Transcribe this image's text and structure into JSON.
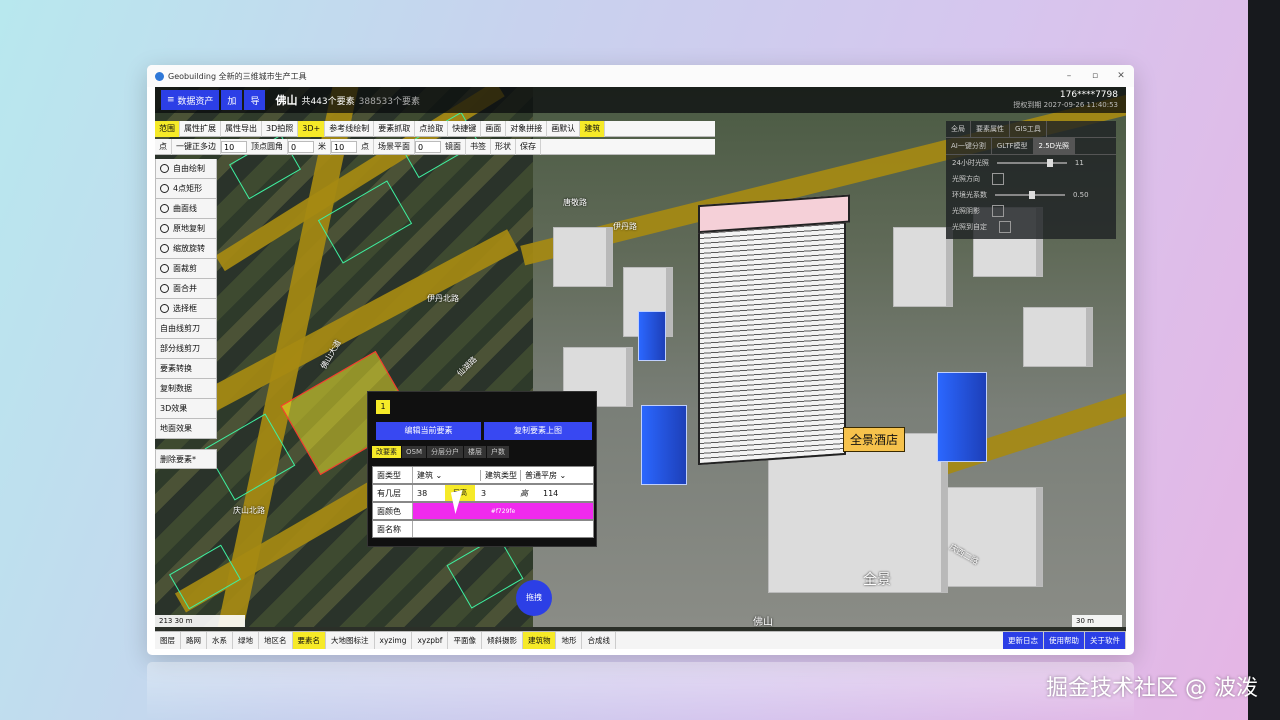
{
  "window": {
    "title": "Geobuilding 全新的三维城市生产工具",
    "min": "–",
    "max": "▫",
    "close": "✕"
  },
  "header": {
    "data_assets": "数据资产",
    "add": "加",
    "import": "导",
    "city": "佛山",
    "count": "共443个要素",
    "count2": "388533个要素",
    "user": "176****7798",
    "expiry": "授权到期 2027-09-26 11:40:53"
  },
  "toolbar1": [
    "范围",
    "属性扩展",
    "属性导出",
    "3D拍照",
    "3D+",
    "参考线绘制",
    "要素抓取",
    "点拾取",
    "快捷键",
    "画面",
    "对象拼接",
    "画默认",
    "建筑"
  ],
  "toolbar2": {
    "point": "点",
    "polygon": "一键正多边",
    "polygon_val": "10",
    "vertex": "顶点圆角",
    "vertex_val": "0",
    "m": "米",
    "points_val": "10",
    "points_label": "点",
    "scene": "场景平面",
    "scene_val": "0",
    "mirror": "镜面",
    "bookmark": "书签",
    "shape": "形状",
    "save": "保存"
  },
  "tools": [
    "自由绘制",
    "4点矩形",
    "曲面线",
    "原地复制",
    "缩放旋转",
    "面裁剪",
    "面合并",
    "选择框",
    "自由线剪刀",
    "部分线剪刀",
    "要素转换",
    "复制数据",
    "3D效果",
    "地面效果"
  ],
  "tools_del": "删除要素*",
  "right_panel": {
    "tabs": [
      "全局",
      "要素属性",
      "GIS工具"
    ],
    "tabs2": [
      "AI一键分割",
      "GLTF模型",
      "2.5D光照"
    ],
    "rows": [
      "24小时光照",
      "光照方向",
      "环境光系数",
      "光照阴影",
      "光照到自定"
    ],
    "values": [
      "11",
      "0.50"
    ]
  },
  "popup": {
    "number": "1",
    "edit_btn": "编辑当前要素",
    "copy_btn": "复制要素上图",
    "tabs": [
      "改要素",
      "OSM",
      "分层分户",
      "楼层",
      "户数"
    ],
    "type_label": "面类型",
    "type_val": "建筑",
    "build_label": "建筑类型",
    "build_val": "普通平房",
    "floors_label": "有几层",
    "floors_val": "38",
    "height_tag": "层高",
    "height_val": "3",
    "h_label": "高",
    "h_val": "114",
    "color_label": "面颜色",
    "color_val": "#f729fe",
    "name_label": "面名称",
    "name_val": ""
  },
  "map_labels": {
    "left": [
      "佛山大道",
      "伊丹北路",
      "仙湖路",
      "庆山北路"
    ],
    "right": [
      "唐敬路",
      "伊丹路",
      "全景酒店",
      "佛山",
      "全景",
      "庆西二路"
    ]
  },
  "hotel": "全景酒店",
  "drag": "拖拽",
  "scale_left": "213   30 m",
  "scale_right": "30 m",
  "bottom": [
    "图层",
    "路网",
    "水系",
    "绿地",
    "地区名",
    "要素名",
    "大地图标注",
    "xyzimg",
    "xyzpbf",
    "平面像",
    "倾斜摄影",
    "建筑物",
    "地形",
    "合成线"
  ],
  "bottom_right": [
    "更新日志",
    "使用帮助",
    "关于软件"
  ],
  "watermark": "掘金技术社区 @ 波泼"
}
